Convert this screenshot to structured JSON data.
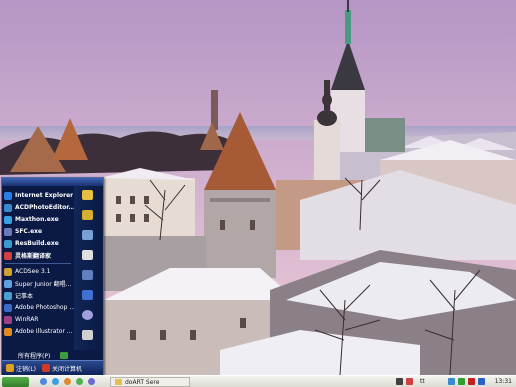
{
  "start_menu": {
    "items": [
      {
        "label": "Internet Explorer",
        "bold": true,
        "icon": "internet-explorer-icon",
        "color": "#2a7de0"
      },
      {
        "label": "ACDPhotoEditor...",
        "bold": true,
        "icon": "acdsee-editor-icon",
        "color": "#3a8ad0"
      },
      {
        "label": "Maxthon.exe",
        "bold": true,
        "icon": "maxthon-icon",
        "color": "#3aa0e0"
      },
      {
        "label": "SFC.exe",
        "bold": true,
        "icon": "sfc-icon",
        "color": "#6a7ac0"
      },
      {
        "label": "ResBuild.exe",
        "bold": true,
        "icon": "resbuild-icon",
        "color": "#3a9ad0"
      },
      {
        "label": "灵格斯翻译家",
        "bold": true,
        "icon": "lingoes-icon",
        "color": "#d04040"
      },
      {
        "label": "ACDSee 3.1",
        "bold": false,
        "icon": "acdsee-icon",
        "color": "#d0a030"
      },
      {
        "label": "Super Junior 翻唱...",
        "bold": false,
        "icon": "media-file-icon",
        "color": "#60a0e0"
      },
      {
        "label": "记事本",
        "bold": false,
        "icon": "notepad-icon",
        "color": "#4aa0d0"
      },
      {
        "label": "Adobe Photoshop ...",
        "bold": false,
        "icon": "photoshop-icon",
        "color": "#3a6ac8"
      },
      {
        "label": "WinRAR",
        "bold": false,
        "icon": "winrar-icon",
        "color": "#a04080"
      },
      {
        "label": "Adobe Illustrator ...",
        "bold": false,
        "icon": "illustrator-icon",
        "color": "#e08a20"
      }
    ],
    "right_icons": [
      {
        "icon": "my-documents-icon",
        "color": "#e6c040"
      },
      {
        "icon": "my-pictures-icon",
        "color": "#d4b030"
      },
      {
        "icon": "my-computer-icon",
        "color": "#7aa0d8"
      },
      {
        "icon": "control-panel-icon",
        "color": "#e0e0e0"
      },
      {
        "icon": "printer-icon",
        "color": "#6080c0"
      },
      {
        "icon": "help-icon",
        "color": "#4070d0"
      },
      {
        "icon": "search-icon",
        "color": "#a0a0e0"
      },
      {
        "icon": "run-icon",
        "color": "#d0d0d0"
      }
    ],
    "all_programs": "所有程序(P)",
    "logoff_label": "注销(L)",
    "shutdown_label": "关闭计算机"
  },
  "taskbar": {
    "task_label": "doART Sere",
    "tray_text": "tt",
    "clock": "13:31"
  },
  "colors": {
    "sky_top": "#b89cc6",
    "sky_bottom": "#e8c8d6",
    "start_green": "#3c9b3c",
    "menu_bg": "#0a1a44"
  }
}
